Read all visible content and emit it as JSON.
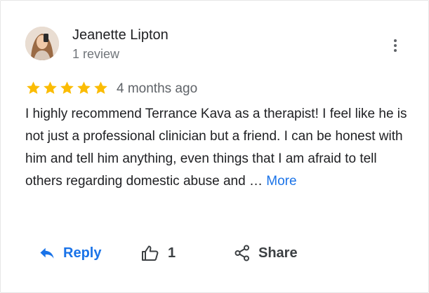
{
  "review": {
    "author_name": "Jeanette Lipton",
    "author_meta": "1 review",
    "rating": 5,
    "rating_max": 5,
    "date": "4 months ago",
    "text": "I highly recommend Terrance Kava as a therapist! I feel like he is not just a professional clinician but a friend. I can be honest with him and tell him anything, even things that I am afraid to tell others regarding domestic abuse and … ",
    "more_label": "More"
  },
  "actions": {
    "reply_label": "Reply",
    "like_count": "1",
    "share_label": "Share"
  },
  "icons": {
    "reply": "reply-arrow-icon",
    "like": "thumbs-up-icon",
    "share": "share-icon",
    "menu": "more-vert-icon",
    "star": "star-icon"
  },
  "colors": {
    "star": "#fbbc04",
    "link": "#1a73e8",
    "text": "#202124",
    "muted": "#70757a"
  }
}
